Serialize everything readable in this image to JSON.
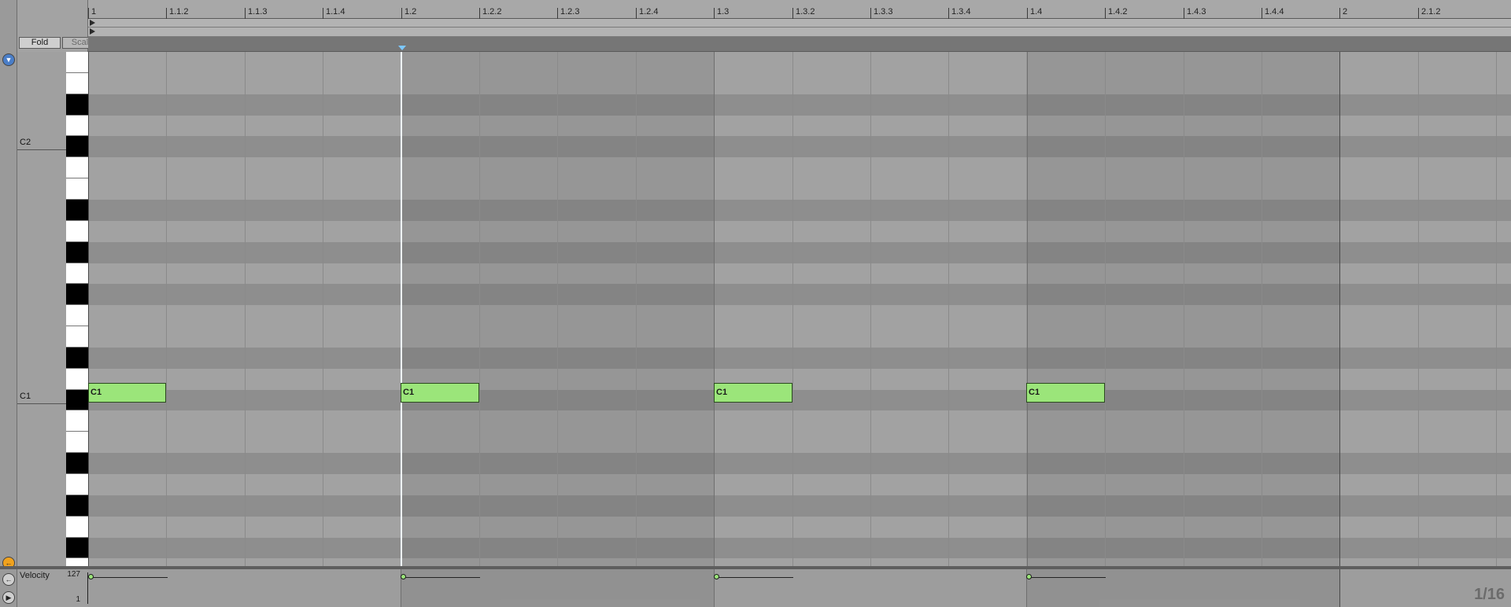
{
  "header": {
    "fold_label": "Fold",
    "scale_label": "Scale"
  },
  "ruler": {
    "labels": [
      "1",
      "1.1.2",
      "1.1.3",
      "1.1.4",
      "1.2",
      "1.2.2",
      "1.2.3",
      "1.2.4",
      "1.3",
      "1.3.2",
      "1.3.3",
      "1.3.4",
      "1.4",
      "1.4.2",
      "1.4.3",
      "1.4.4",
      "2",
      "2.1.2"
    ]
  },
  "piano": {
    "octave_labels": [
      "C2",
      "C1"
    ]
  },
  "notes": [
    {
      "label": "C1",
      "pitch": "C1",
      "start": "1",
      "length": "1/16"
    },
    {
      "label": "C1",
      "pitch": "C1",
      "start": "1.2",
      "length": "1/16"
    },
    {
      "label": "C1",
      "pitch": "C1",
      "start": "1.3",
      "length": "1/16"
    },
    {
      "label": "C1",
      "pitch": "C1",
      "start": "1.4",
      "length": "1/16"
    }
  ],
  "velocity": {
    "title": "Velocity",
    "max_label": "127",
    "min_label": "1",
    "values": [
      127,
      127,
      127,
      127
    ]
  },
  "quantization": "1/16",
  "colors": {
    "note_fill": "#9be57a",
    "playhead": "#eef6ff",
    "marker": "#7cc8ff"
  },
  "icons": {
    "top_strip": "expand-icon",
    "bottom_strip_1": "back-arrow-icon",
    "bottom_strip_2": "back-arrow-icon",
    "bottom_strip_3": "play-icon"
  }
}
